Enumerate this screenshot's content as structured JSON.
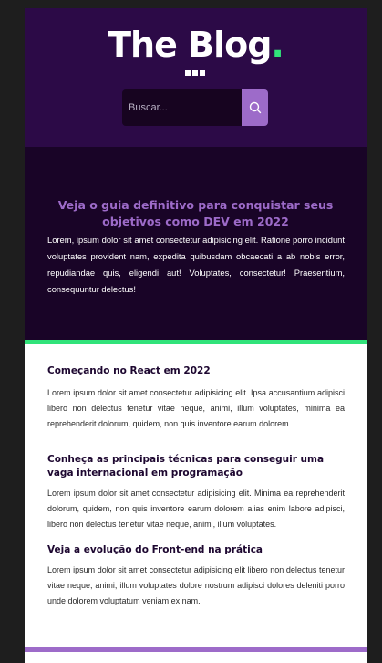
{
  "header": {
    "logo_text": "The Blog",
    "logo_dot": ".",
    "search_placeholder": "Buscar..."
  },
  "hero": {
    "title": "Veja o guia definitivo para conquistar seus objetivos como DEV em 2022",
    "text": "Lorem, ipsum dolor sit amet consectetur adipisicing elit. Ratione porro incidunt voluptates provident nam, expedita quibusdam obcaecati a ab nobis error, repudiandae quis, eligendi aut! Voluptates, consectetur! Praesentium, consequuntur delectus!"
  },
  "articles": [
    {
      "title": "Começando no React em 2022",
      "text": "Lorem ipsum dolor sit amet consectetur adipisicing elit. Ipsa accusantium adipisci libero non delectus tenetur vitae neque, animi, illum voluptates, minima ea reprehenderit dolorum, quidem, non quis inventore earum dolorem."
    },
    {
      "title": "Conheça as principais técnicas para conseguir uma vaga internacional em programação",
      "text": "Lorem ipsum dolor sit amet consectetur adipisicing elit. Minima ea reprehenderit dolorum, quidem, non quis inventore earum dolorem alias enim labore adipisci, libero non delectus tenetur vitae neque, animi, illum voluptates."
    },
    {
      "title": "Veja a evolução do Front-end na prática",
      "text": "Lorem ipsum dolor sit amet consectetur adipisicing elit libero non delectus tenetur vitae neque, animi, illum voluptates dolore nostrum adipisci dolores deleniti porro unde dolorem voluptatum veniam ex nam."
    }
  ],
  "icons": {
    "search": "search-icon",
    "menu": "menu-dots-icon"
  },
  "colors": {
    "header_bg": "#2c0a47",
    "hero_bg": "#190427",
    "accent_purple": "#9d6bc9",
    "accent_green": "#31e37a"
  }
}
